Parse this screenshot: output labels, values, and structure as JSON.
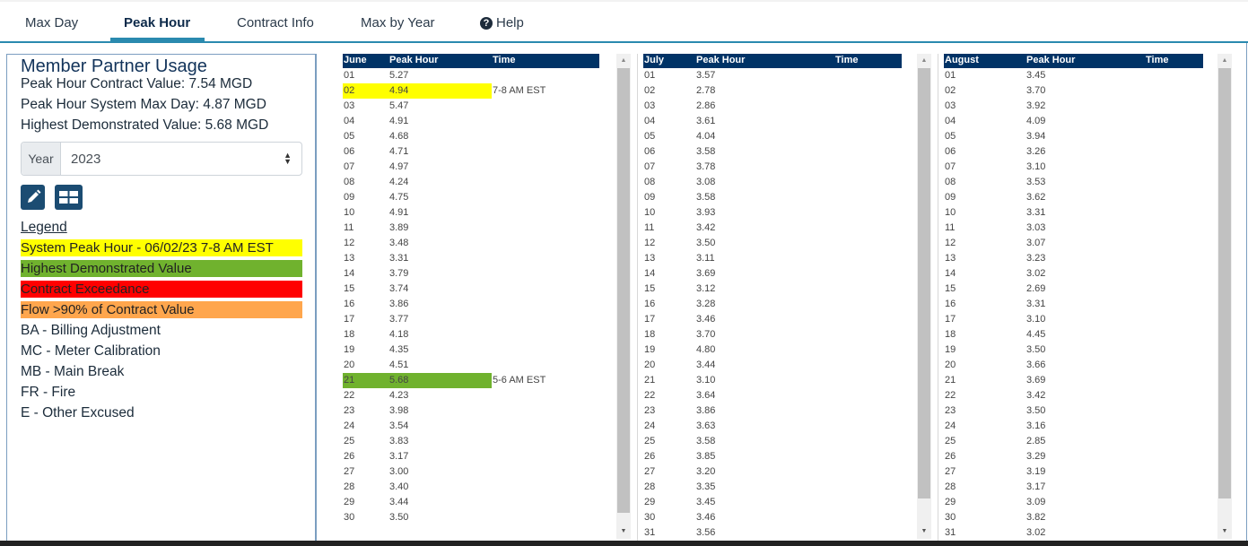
{
  "nav": {
    "tabs": [
      {
        "label": "Max Day",
        "active": false
      },
      {
        "label": "Peak Hour",
        "active": true
      },
      {
        "label": "Contract Info",
        "active": false
      },
      {
        "label": "Max by Year",
        "active": false
      },
      {
        "label": "Help",
        "active": false,
        "icon": "question-circle-icon"
      }
    ]
  },
  "panel": {
    "title": "Member Partner Usage",
    "contract_value": "Peak Hour Contract Value: 7.54 MGD",
    "system_max_day": "Peak Hour System Max Day: 4.87 MGD",
    "highest_demonstrated": "Highest Demonstrated Value: 5.68 MGD",
    "year_label": "Year",
    "year_value": "2023",
    "buttons": [
      {
        "icon": "pencil-icon",
        "label": "edit"
      },
      {
        "icon": "grid-icon",
        "label": "table view"
      }
    ],
    "legend_title": "Legend",
    "legend_colored": [
      {
        "label": "System Peak Hour - 06/02/23 7-8 AM EST",
        "color": "#ffff00"
      },
      {
        "label": "Highest Demonstrated Value",
        "color": "#70b22e"
      },
      {
        "label": "Contract Exceedance",
        "color": "#ff0000"
      },
      {
        "label": "Flow >90% of Contract Value",
        "color": "#ffa64d"
      }
    ],
    "legend_codes": [
      "BA - Billing Adjustment",
      "MC - Meter Calibration",
      "MB - Main Break",
      "FR - Fire",
      "E - Other Excused"
    ]
  },
  "colors": {
    "header_bg": "#003366",
    "accent": "#2a8aaf",
    "peak": "#ffff00",
    "highest": "#70b22e"
  },
  "months": [
    {
      "name": "June",
      "col_peak": "Peak Hour",
      "col_time": "Time",
      "rows": [
        {
          "day": "01",
          "value": "5.27",
          "time": ""
        },
        {
          "day": "02",
          "value": "4.94",
          "time": "7-8 AM EST",
          "highlight": "peak"
        },
        {
          "day": "03",
          "value": "5.47",
          "time": ""
        },
        {
          "day": "04",
          "value": "4.91",
          "time": ""
        },
        {
          "day": "05",
          "value": "4.68",
          "time": ""
        },
        {
          "day": "06",
          "value": "4.71",
          "time": ""
        },
        {
          "day": "07",
          "value": "4.97",
          "time": ""
        },
        {
          "day": "08",
          "value": "4.24",
          "time": ""
        },
        {
          "day": "09",
          "value": "4.75",
          "time": ""
        },
        {
          "day": "10",
          "value": "4.91",
          "time": ""
        },
        {
          "day": "11",
          "value": "3.89",
          "time": ""
        },
        {
          "day": "12",
          "value": "3.48",
          "time": ""
        },
        {
          "day": "13",
          "value": "3.31",
          "time": ""
        },
        {
          "day": "14",
          "value": "3.79",
          "time": ""
        },
        {
          "day": "15",
          "value": "3.74",
          "time": ""
        },
        {
          "day": "16",
          "value": "3.86",
          "time": ""
        },
        {
          "day": "17",
          "value": "3.77",
          "time": ""
        },
        {
          "day": "18",
          "value": "4.18",
          "time": ""
        },
        {
          "day": "19",
          "value": "4.35",
          "time": ""
        },
        {
          "day": "20",
          "value": "4.51",
          "time": ""
        },
        {
          "day": "21",
          "value": "5.68",
          "time": "5-6 AM EST",
          "highlight": "highest"
        },
        {
          "day": "22",
          "value": "4.23",
          "time": ""
        },
        {
          "day": "23",
          "value": "3.98",
          "time": ""
        },
        {
          "day": "24",
          "value": "3.54",
          "time": ""
        },
        {
          "day": "25",
          "value": "3.83",
          "time": ""
        },
        {
          "day": "26",
          "value": "3.17",
          "time": ""
        },
        {
          "day": "27",
          "value": "3.00",
          "time": ""
        },
        {
          "day": "28",
          "value": "3.40",
          "time": ""
        },
        {
          "day": "29",
          "value": "3.44",
          "time": ""
        },
        {
          "day": "30",
          "value": "3.50",
          "time": ""
        }
      ]
    },
    {
      "name": "July",
      "col_peak": "Peak Hour",
      "col_time": "Time",
      "rows": [
        {
          "day": "01",
          "value": "3.57",
          "time": ""
        },
        {
          "day": "02",
          "value": "2.78",
          "time": ""
        },
        {
          "day": "03",
          "value": "2.86",
          "time": ""
        },
        {
          "day": "04",
          "value": "3.61",
          "time": ""
        },
        {
          "day": "05",
          "value": "4.04",
          "time": ""
        },
        {
          "day": "06",
          "value": "3.58",
          "time": ""
        },
        {
          "day": "07",
          "value": "3.78",
          "time": ""
        },
        {
          "day": "08",
          "value": "3.08",
          "time": ""
        },
        {
          "day": "09",
          "value": "3.58",
          "time": ""
        },
        {
          "day": "10",
          "value": "3.93",
          "time": ""
        },
        {
          "day": "11",
          "value": "3.42",
          "time": ""
        },
        {
          "day": "12",
          "value": "3.50",
          "time": ""
        },
        {
          "day": "13",
          "value": "3.11",
          "time": ""
        },
        {
          "day": "14",
          "value": "3.69",
          "time": ""
        },
        {
          "day": "15",
          "value": "3.12",
          "time": ""
        },
        {
          "day": "16",
          "value": "3.28",
          "time": ""
        },
        {
          "day": "17",
          "value": "3.46",
          "time": ""
        },
        {
          "day": "18",
          "value": "3.70",
          "time": ""
        },
        {
          "day": "19",
          "value": "4.80",
          "time": ""
        },
        {
          "day": "20",
          "value": "3.44",
          "time": ""
        },
        {
          "day": "21",
          "value": "3.10",
          "time": ""
        },
        {
          "day": "22",
          "value": "3.64",
          "time": ""
        },
        {
          "day": "23",
          "value": "3.86",
          "time": ""
        },
        {
          "day": "24",
          "value": "3.63",
          "time": ""
        },
        {
          "day": "25",
          "value": "3.58",
          "time": ""
        },
        {
          "day": "26",
          "value": "3.85",
          "time": ""
        },
        {
          "day": "27",
          "value": "3.20",
          "time": ""
        },
        {
          "day": "28",
          "value": "3.35",
          "time": ""
        },
        {
          "day": "29",
          "value": "3.45",
          "time": ""
        },
        {
          "day": "30",
          "value": "3.46",
          "time": ""
        },
        {
          "day": "31",
          "value": "3.56",
          "time": ""
        }
      ]
    },
    {
      "name": "August",
      "col_peak": "Peak Hour",
      "col_time": "Time",
      "rows": [
        {
          "day": "01",
          "value": "3.45",
          "time": ""
        },
        {
          "day": "02",
          "value": "3.70",
          "time": ""
        },
        {
          "day": "03",
          "value": "3.92",
          "time": ""
        },
        {
          "day": "04",
          "value": "4.09",
          "time": ""
        },
        {
          "day": "05",
          "value": "3.94",
          "time": ""
        },
        {
          "day": "06",
          "value": "3.26",
          "time": ""
        },
        {
          "day": "07",
          "value": "3.10",
          "time": ""
        },
        {
          "day": "08",
          "value": "3.53",
          "time": ""
        },
        {
          "day": "09",
          "value": "3.62",
          "time": ""
        },
        {
          "day": "10",
          "value": "3.31",
          "time": ""
        },
        {
          "day": "11",
          "value": "3.03",
          "time": ""
        },
        {
          "day": "12",
          "value": "3.07",
          "time": ""
        },
        {
          "day": "13",
          "value": "3.23",
          "time": ""
        },
        {
          "day": "14",
          "value": "3.02",
          "time": ""
        },
        {
          "day": "15",
          "value": "2.69",
          "time": ""
        },
        {
          "day": "16",
          "value": "3.31",
          "time": ""
        },
        {
          "day": "17",
          "value": "3.10",
          "time": ""
        },
        {
          "day": "18",
          "value": "4.45",
          "time": ""
        },
        {
          "day": "19",
          "value": "3.50",
          "time": ""
        },
        {
          "day": "20",
          "value": "3.66",
          "time": ""
        },
        {
          "day": "21",
          "value": "3.69",
          "time": ""
        },
        {
          "day": "22",
          "value": "3.42",
          "time": ""
        },
        {
          "day": "23",
          "value": "3.50",
          "time": ""
        },
        {
          "day": "24",
          "value": "3.16",
          "time": ""
        },
        {
          "day": "25",
          "value": "2.85",
          "time": ""
        },
        {
          "day": "26",
          "value": "3.29",
          "time": ""
        },
        {
          "day": "27",
          "value": "3.19",
          "time": ""
        },
        {
          "day": "28",
          "value": "3.17",
          "time": ""
        },
        {
          "day": "29",
          "value": "3.09",
          "time": ""
        },
        {
          "day": "30",
          "value": "3.82",
          "time": ""
        },
        {
          "day": "31",
          "value": "3.02",
          "time": ""
        }
      ]
    }
  ]
}
